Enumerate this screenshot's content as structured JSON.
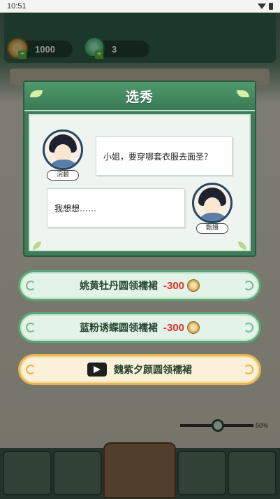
{
  "status_bar": {
    "time": "10:51"
  },
  "resources": {
    "coins": "1000",
    "gems": "3"
  },
  "dialog": {
    "title": "选秀",
    "speaker1": {
      "name": "浣碧",
      "line": "小姐，要穿哪套衣服去面圣？"
    },
    "speaker2": {
      "name": "甄嬛",
      "line": "我想想……"
    }
  },
  "options": [
    {
      "label": "姚黄牡丹圆领襦裙",
      "price": "-300"
    },
    {
      "label": "蓝粉诱蝶圆领襦裙",
      "price": "-300"
    },
    {
      "label": "魏紫夕颜圆领襦裙"
    }
  ],
  "slider": {
    "value_label": "50%"
  },
  "colors": {
    "dialog_green": "#3f7d58",
    "price_red": "#e02f2f",
    "gold_border": "#e6b553"
  }
}
